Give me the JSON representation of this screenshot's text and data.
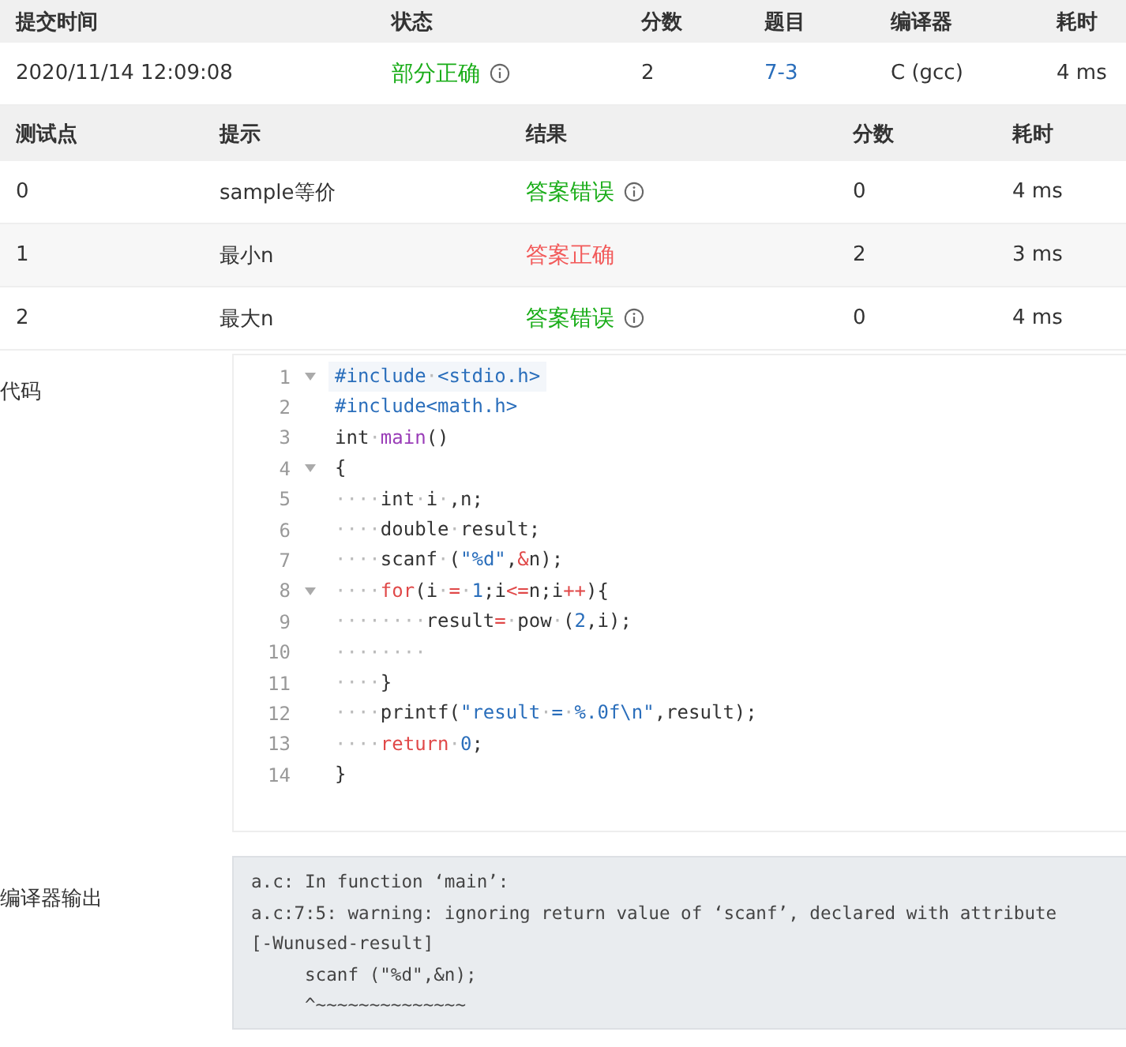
{
  "submission": {
    "columns": [
      "提交时间",
      "状态",
      "分数",
      "题目",
      "编译器",
      "耗时"
    ],
    "row": {
      "time": "2020/11/14 12:09:08",
      "status": {
        "text": "部分正确",
        "color": "#1aad19",
        "info": true
      },
      "score": "2",
      "problem": "7-3",
      "compiler": "C (gcc)",
      "duration": "4 ms"
    }
  },
  "tests": {
    "columns": [
      "测试点",
      "提示",
      "结果",
      "分数",
      "耗时"
    ],
    "rows": [
      {
        "case": "0",
        "hint": "sample等价",
        "result": {
          "text": "答案错误",
          "color": "#1aad19",
          "info": true
        },
        "score": "0",
        "duration": "4 ms"
      },
      {
        "case": "1",
        "hint": "最小n",
        "result": {
          "text": "答案正确",
          "color": "#f25a5a",
          "info": false
        },
        "score": "2",
        "duration": "3 ms"
      },
      {
        "case": "2",
        "hint": "最大n",
        "result": {
          "text": "答案错误",
          "color": "#1aad19",
          "info": true
        },
        "score": "0",
        "duration": "4 ms"
      }
    ]
  },
  "code": {
    "label": "代码",
    "lines": [
      {
        "no": "1",
        "fold": true,
        "active": true,
        "tokens": [
          {
            "t": "#include",
            "kind": "pre"
          },
          {
            "t": "·",
            "kind": "ws"
          },
          {
            "t": "<stdio.h>",
            "kind": "pre"
          }
        ]
      },
      {
        "no": "2",
        "fold": false,
        "active": false,
        "tokens": [
          {
            "t": "#include<math.h>",
            "kind": "pre"
          }
        ]
      },
      {
        "no": "3",
        "fold": false,
        "active": false,
        "tokens": [
          {
            "t": "int",
            "kind": "plain"
          },
          {
            "t": "·",
            "kind": "ws"
          },
          {
            "t": "main",
            "kind": "func"
          },
          {
            "t": "()",
            "kind": "plain"
          }
        ]
      },
      {
        "no": "4",
        "fold": true,
        "active": false,
        "tokens": [
          {
            "t": "{",
            "kind": "plain"
          }
        ]
      },
      {
        "no": "5",
        "fold": false,
        "active": false,
        "tokens": [
          {
            "t": "····",
            "kind": "ws"
          },
          {
            "t": "int",
            "kind": "plain"
          },
          {
            "t": "·",
            "kind": "ws"
          },
          {
            "t": "i",
            "kind": "plain"
          },
          {
            "t": "·",
            "kind": "ws"
          },
          {
            "t": ",n;",
            "kind": "plain"
          }
        ]
      },
      {
        "no": "6",
        "fold": false,
        "active": false,
        "tokens": [
          {
            "t": "····",
            "kind": "ws"
          },
          {
            "t": "double",
            "kind": "plain"
          },
          {
            "t": "·",
            "kind": "ws"
          },
          {
            "t": "result;",
            "kind": "plain"
          }
        ]
      },
      {
        "no": "7",
        "fold": false,
        "active": false,
        "tokens": [
          {
            "t": "····",
            "kind": "ws"
          },
          {
            "t": "scanf",
            "kind": "plain"
          },
          {
            "t": "·",
            "kind": "ws"
          },
          {
            "t": "(",
            "kind": "plain"
          },
          {
            "t": "\"%d\"",
            "kind": "str"
          },
          {
            "t": ",",
            "kind": "plain"
          },
          {
            "t": "&",
            "kind": "op"
          },
          {
            "t": "n);",
            "kind": "plain"
          }
        ]
      },
      {
        "no": "8",
        "fold": true,
        "active": false,
        "tokens": [
          {
            "t": "····",
            "kind": "ws"
          },
          {
            "t": "for",
            "kind": "kw"
          },
          {
            "t": "(i",
            "kind": "plain"
          },
          {
            "t": "·",
            "kind": "ws"
          },
          {
            "t": "=",
            "kind": "op"
          },
          {
            "t": "·",
            "kind": "ws"
          },
          {
            "t": "1",
            "kind": "num"
          },
          {
            "t": ";i",
            "kind": "plain"
          },
          {
            "t": "<=",
            "kind": "op"
          },
          {
            "t": "n;i",
            "kind": "plain"
          },
          {
            "t": "++",
            "kind": "op"
          },
          {
            "t": "){",
            "kind": "plain"
          }
        ]
      },
      {
        "no": "9",
        "fold": false,
        "active": false,
        "tokens": [
          {
            "t": "········",
            "kind": "ws"
          },
          {
            "t": "result",
            "kind": "plain"
          },
          {
            "t": "=",
            "kind": "op"
          },
          {
            "t": "·",
            "kind": "ws"
          },
          {
            "t": "pow",
            "kind": "plain"
          },
          {
            "t": "·",
            "kind": "ws"
          },
          {
            "t": "(",
            "kind": "plain"
          },
          {
            "t": "2",
            "kind": "num"
          },
          {
            "t": ",i);",
            "kind": "plain"
          }
        ]
      },
      {
        "no": "10",
        "fold": false,
        "active": false,
        "tokens": [
          {
            "t": "········",
            "kind": "ws"
          }
        ]
      },
      {
        "no": "11",
        "fold": false,
        "active": false,
        "tokens": [
          {
            "t": "····",
            "kind": "ws"
          },
          {
            "t": "}",
            "kind": "plain"
          }
        ]
      },
      {
        "no": "12",
        "fold": false,
        "active": false,
        "tokens": [
          {
            "t": "····",
            "kind": "ws"
          },
          {
            "t": "printf(",
            "kind": "plain"
          },
          {
            "t": "\"result",
            "kind": "str"
          },
          {
            "t": "·",
            "kind": "ws"
          },
          {
            "t": "=",
            "kind": "str"
          },
          {
            "t": "·",
            "kind": "ws"
          },
          {
            "t": "%.0f\\n\"",
            "kind": "str"
          },
          {
            "t": ",result);",
            "kind": "plain"
          }
        ]
      },
      {
        "no": "13",
        "fold": false,
        "active": false,
        "tokens": [
          {
            "t": "····",
            "kind": "ws"
          },
          {
            "t": "return",
            "kind": "kw"
          },
          {
            "t": "·",
            "kind": "ws"
          },
          {
            "t": "0",
            "kind": "num"
          },
          {
            "t": ";",
            "kind": "plain"
          }
        ]
      },
      {
        "no": "14",
        "fold": false,
        "active": false,
        "tokens": [
          {
            "t": "}",
            "kind": "plain"
          }
        ]
      }
    ]
  },
  "compiler_output": {
    "label": "编译器输出",
    "lines": [
      "a.c: In function ‘main’:",
      "a.c:7:5: warning: ignoring return value of ‘scanf’, declared with attribute",
      "[-Wunused-result]",
      "     scanf (\"%d\",&n);",
      "     ^~~~~~~~~~~~~~~"
    ]
  }
}
